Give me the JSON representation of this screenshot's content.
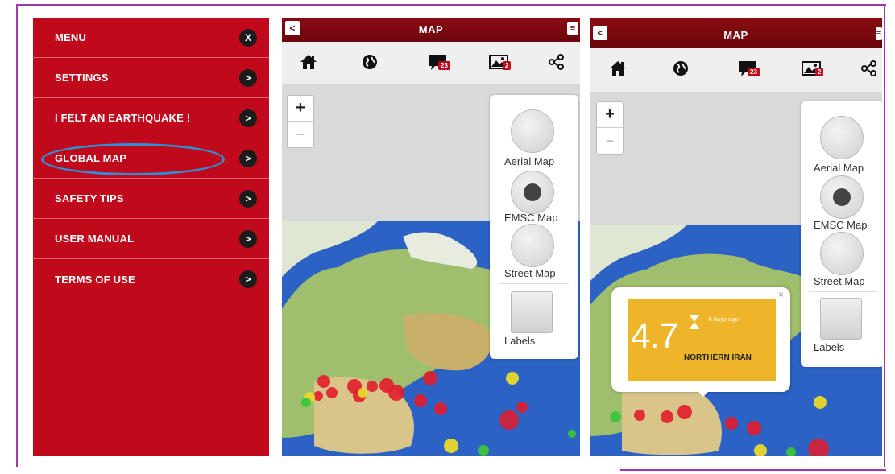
{
  "menu": {
    "items": [
      {
        "label": "MENU",
        "button": "X"
      },
      {
        "label": "SETTINGS",
        "button": ">"
      },
      {
        "label": "I FELT AN EARTHQUAKE !",
        "button": ">"
      },
      {
        "label": "GLOBAL MAP",
        "button": ">"
      },
      {
        "label": "SAFETY TIPS",
        "button": ">"
      },
      {
        "label": "USER MANUAL",
        "button": ">"
      },
      {
        "label": "TERMS OF USE",
        "button": ">"
      }
    ]
  },
  "screens": [
    {
      "title": "MAP",
      "back": "<",
      "menu_glyph": "≡",
      "toolbar": {
        "comments_badge": "23",
        "photos_badge": "2"
      },
      "zoom": {
        "plus": "+",
        "minus": "−"
      },
      "layers": {
        "aerial": "Aerial Map",
        "emsc": "EMSC Map",
        "street": "Street Map",
        "labels": "Labels"
      }
    },
    {
      "title": "MAP",
      "back": "<",
      "menu_glyph": "≡",
      "toolbar": {
        "comments_badge": "23",
        "photos_badge": "2"
      },
      "zoom": {
        "plus": "+",
        "minus": "−"
      },
      "layers": {
        "aerial": "Aerial Map",
        "emsc": "EMSC Map",
        "street": "Street Map",
        "labels": "Labels"
      },
      "popup": {
        "magnitude": "4.7",
        "time_ago": "4 days ago",
        "region": "NORTHERN IRAN",
        "close": "×"
      }
    }
  ],
  "colors": {
    "menu_red": "#c0091b",
    "header_dark_red": "#6a060c",
    "frame_purple": "#9b3aa8",
    "highlight_blue": "#2e8fd6",
    "popup_yellow": "#eeb52a"
  }
}
